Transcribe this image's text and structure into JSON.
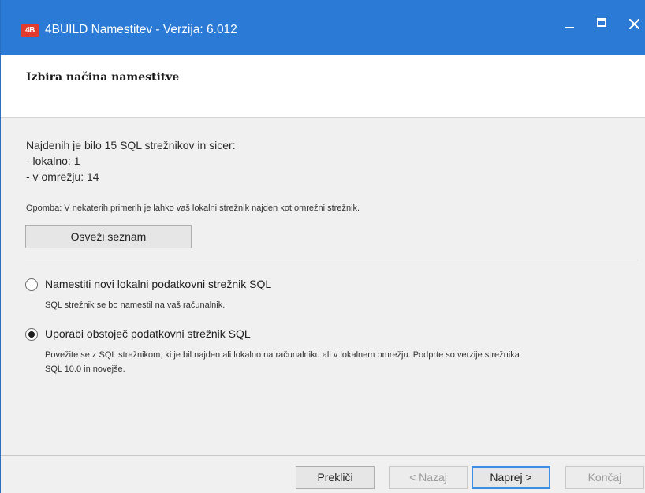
{
  "window": {
    "logo_text": "4B",
    "title": "4BUILD Namestitev - Verzija: 6.012"
  },
  "header": {
    "title": "Izbira načina namestitve"
  },
  "main": {
    "found_line1": "Najdenih je bilo 15 SQL strežnikov in sicer:",
    "found_line2": "- lokalno: 1",
    "found_line3": "- v omrežju: 14",
    "note": "Opomba: V nekaterih primerih je lahko vaš lokalni strežnik najden kot omrežni strežnik.",
    "refresh_label": "Osveži seznam",
    "options": [
      {
        "label": "Namestiti novi lokalni podatkovni strežnik SQL",
        "description": "SQL strežnik se bo namestil na vaš računalnik.",
        "checked": false
      },
      {
        "label": "Uporabi obstoječ podatkovni strežnik SQL",
        "description_line1": "Povežite se z SQL strežnikom, ki je bil najden ali lokalno na računalniku ali v lokalnem omrežju. Podprte so verzije strežnika",
        "description_line2": "SQL 10.0 in novejše.",
        "checked": true
      }
    ]
  },
  "footer": {
    "cancel_label": "Prekliči",
    "back_label": "< Nazaj",
    "next_label": "Naprej >",
    "finish_label": "Končaj"
  },
  "colors": {
    "titlebar": "#2b7bd6",
    "logo": "#e23a2c",
    "focus_border": "#3a8ee6"
  }
}
